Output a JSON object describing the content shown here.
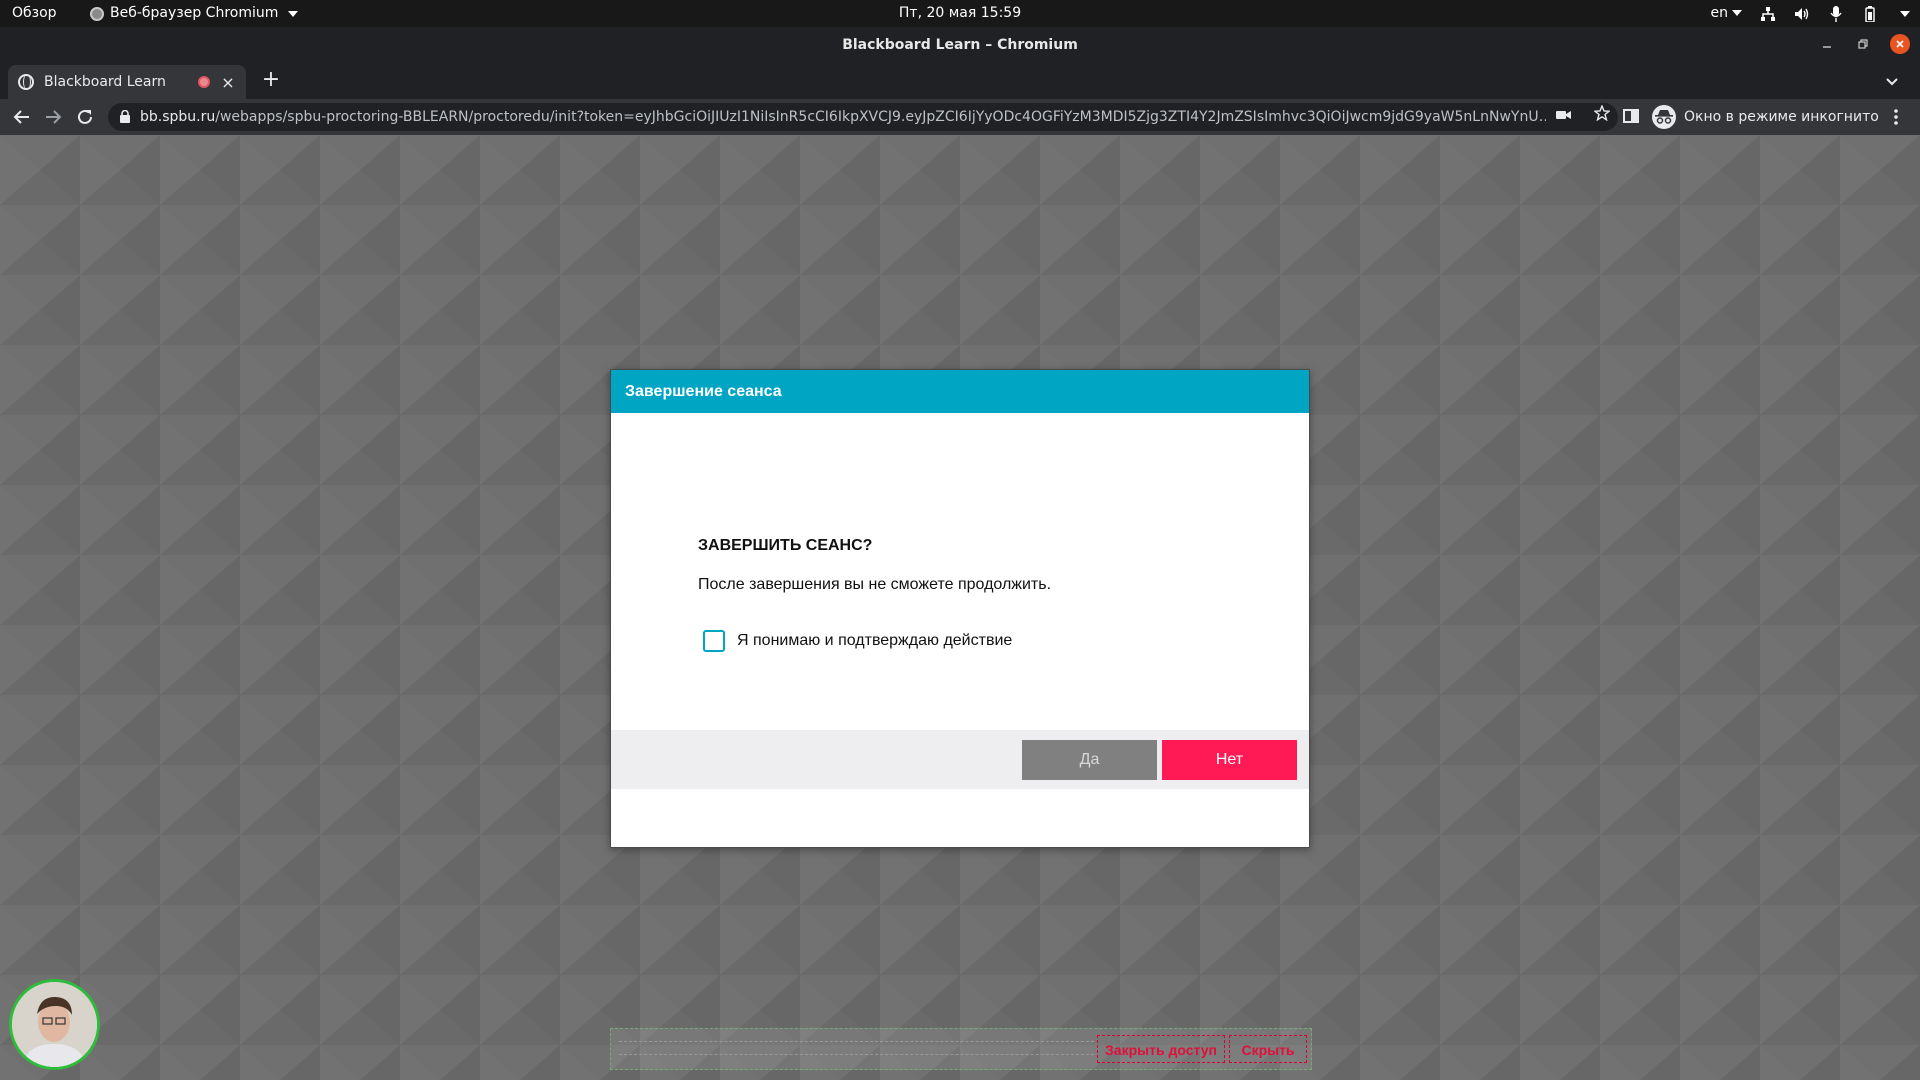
{
  "system_bar": {
    "overview": "Обзор",
    "app_menu": "Веб-браузер Chromium",
    "clock": "Пт, 20 мая  15:59",
    "language": "en"
  },
  "window": {
    "title": "Blackboard Learn – Chromium"
  },
  "tab": {
    "title": "Blackboard Learn"
  },
  "address_bar": {
    "host": "bb.spbu.ru",
    "path": "/webapps/spbu-proctoring-BBLEARN/proctoredu/init?token=eyJhbGciOiJIUzI1NiIsInR5cCI6IkpXVCJ9.eyJpZCI6IjYyODc4OGFiYzM3MDI5Zjg3ZTI4Y2JmZSIsImhvc3QiOiJwcm9jdG9yaW5nLnNwYnUucnUiLCJ1c2..."
  },
  "incognito": {
    "label": "Окно в режиме инкогнито"
  },
  "dialog": {
    "title": "Завершение сеанса",
    "heading": "ЗАВЕРШИТЬ СЕАНС?",
    "text": "После завершения вы не сможете продолжить.",
    "checkbox_label": "Я понимаю и подтверждаю действие",
    "checkbox_checked": false,
    "yes_label": "Да",
    "no_label": "Нет",
    "header_color": "#00a5c3",
    "no_color": "#ff1a56"
  },
  "share_bar": {
    "stop_label": "Закрыть доступ",
    "hide_label": "Скрыть"
  }
}
